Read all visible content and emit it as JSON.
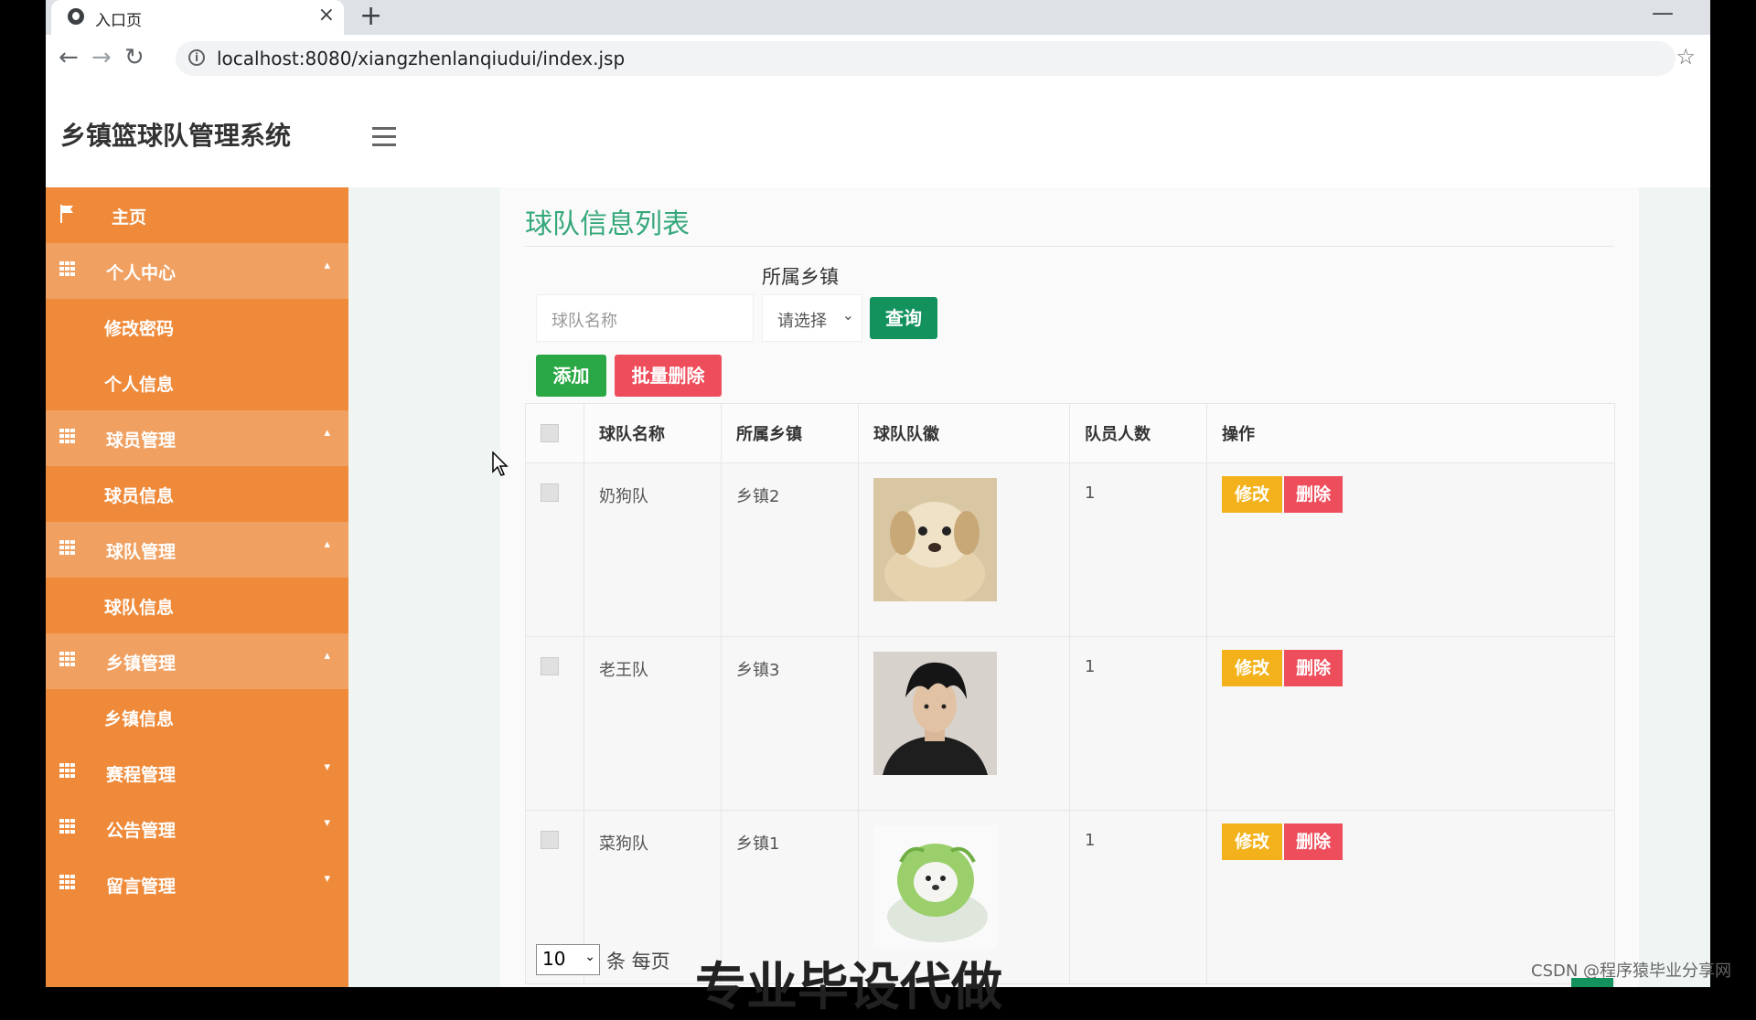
{
  "browser": {
    "tab_title": "入口页",
    "url": "localhost:8080/xiangzhenlanqiudui/index.jsp"
  },
  "app": {
    "title": "乡镇篮球队管理系统"
  },
  "sidebar": {
    "items": [
      {
        "label": "主页"
      },
      {
        "label": "个人中心"
      },
      {
        "label": "修改密码"
      },
      {
        "label": "个人信息"
      },
      {
        "label": "球员管理"
      },
      {
        "label": "球员信息"
      },
      {
        "label": "球队管理"
      },
      {
        "label": "球队信息"
      },
      {
        "label": "乡镇管理"
      },
      {
        "label": "乡镇信息"
      },
      {
        "label": "赛程管理"
      },
      {
        "label": "公告管理"
      },
      {
        "label": "留言管理"
      }
    ]
  },
  "main": {
    "page_title": "球队信息列表",
    "search": {
      "name_placeholder": "球队名称",
      "town_label": "所属乡镇",
      "town_select": "请选择",
      "query_button": "查询"
    },
    "toolbar": {
      "add_button": "添加",
      "batch_delete_button": "批量删除"
    },
    "table": {
      "headers": [
        "球队名称",
        "所属乡镇",
        "球队队徽",
        "队员人数",
        "操作"
      ],
      "rows": [
        {
          "name": "奶狗队",
          "town": "乡镇2",
          "logo": "puppy-photo",
          "members": "1"
        },
        {
          "name": "老王队",
          "town": "乡镇3",
          "logo": "man-portrait",
          "members": "1"
        },
        {
          "name": "菜狗队",
          "town": "乡镇1",
          "logo": "cabbage-dog",
          "members": "1"
        }
      ],
      "edit_label": "修改",
      "delete_label": "删除"
    },
    "pagination": {
      "page_size": "10",
      "per_page_text": "条 每页"
    }
  },
  "overlay_text": "专业毕设代做",
  "watermark": "CSDN @程序猿毕业分享网",
  "colors": {
    "sidebar": "#ee8a3a",
    "title_green": "#35a87a",
    "query": "#13925e",
    "add": "#2aa845",
    "danger": "#ee4d5b",
    "edit": "#f3b21c"
  }
}
